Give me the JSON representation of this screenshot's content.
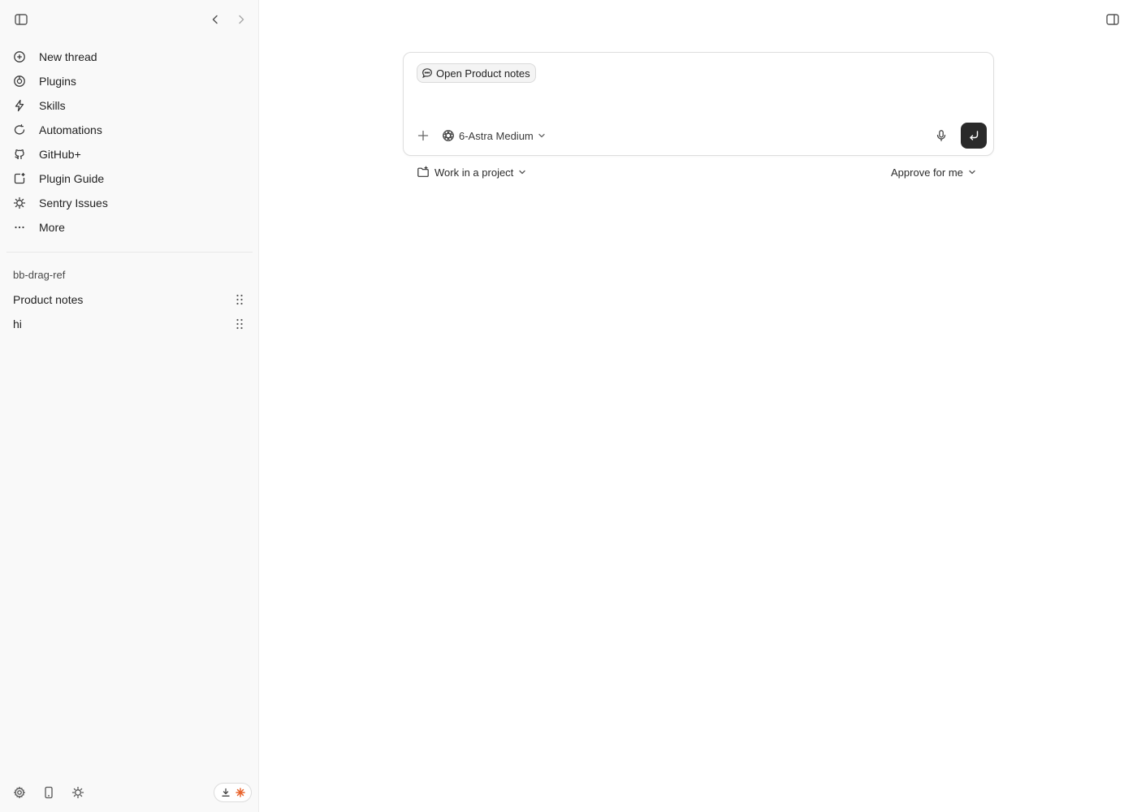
{
  "sidebar": {
    "nav_items": [
      {
        "label": "New thread",
        "icon": "plus-circle-icon"
      },
      {
        "label": "Plugins",
        "icon": "plugin-icon"
      },
      {
        "label": "Skills",
        "icon": "bolt-icon"
      },
      {
        "label": "Automations",
        "icon": "loop-icon"
      },
      {
        "label": "GitHub+",
        "icon": "github-icon"
      },
      {
        "label": "Plugin Guide",
        "icon": "guide-icon"
      },
      {
        "label": "Sentry Issues",
        "icon": "bug-icon"
      },
      {
        "label": "More",
        "icon": "ellipsis-icon"
      }
    ],
    "section_label": "bb-drag-ref",
    "threads": [
      {
        "label": "Product notes"
      },
      {
        "label": "hi"
      }
    ]
  },
  "composer": {
    "chip_label": "Open Product notes",
    "model_label": "6-Astra Medium"
  },
  "footer": {
    "project_label": "Work in a project",
    "approval_label": "Approve for me"
  },
  "colors": {
    "sidebar_bg": "#f9f9f9",
    "send_button": "#2a2a2a",
    "accent_orange": "#e8622a"
  }
}
